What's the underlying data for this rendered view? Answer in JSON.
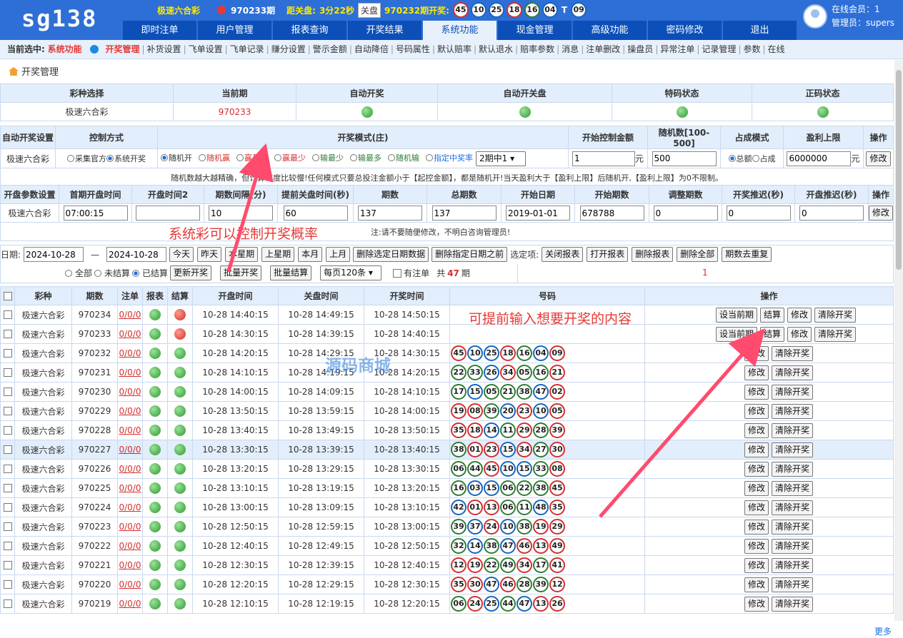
{
  "app": {
    "logo": "sg138"
  },
  "ticker": {
    "lottery": "极速六合彩",
    "period": "970233期",
    "countdown_label": "距关盘:",
    "countdown": "3分22秒",
    "closed": "关盘",
    "last_label": "970232期开奖:",
    "last_balls": [
      "45",
      "10",
      "25",
      "18",
      "16",
      "04"
    ],
    "t": "T",
    "special": "09"
  },
  "nav": [
    "即时注单",
    "用户管理",
    "报表查询",
    "开奖结果",
    "系统功能",
    "现金管理",
    "高级功能",
    "密码修改",
    "退出"
  ],
  "user": {
    "online": "在线会员：1",
    "admin": "管理员：supers"
  },
  "subnav": {
    "label": "当前选中:",
    "current": "系统功能",
    "items": [
      "开奖管理",
      "补货设置",
      "飞单设置",
      "飞单记录",
      "赚分设置",
      "警示金额",
      "自动降倍",
      "号码属性",
      "默认赔率",
      "默认退水",
      "赔率参数",
      "消息",
      "注单删改",
      "操盘员",
      "异常注单",
      "记录管理",
      "参数",
      "在线"
    ]
  },
  "breadcrumb": "开奖管理",
  "status_table": {
    "headers": [
      "彩种选择",
      "当前期",
      "自动开奖",
      "自动开关盘",
      "特码状态",
      "正码状态"
    ],
    "lottery": "极速六合彩",
    "period": "970233"
  },
  "auto_table": {
    "headers": [
      "自动开奖设置",
      "控制方式",
      "开奖模式(庄)",
      "开始控制金额",
      "随机数[100-500]",
      "占成模式",
      "盈利上限",
      "操作"
    ],
    "name": "极速六合彩",
    "control": [
      "采集官方",
      "系统开奖"
    ],
    "modes": [
      "随机开",
      "随机赢",
      "赢最多",
      "赢最少",
      "输最少",
      "输最多",
      "随机输"
    ],
    "specified": "指定中奖率",
    "specified_option": "2期中1",
    "start_amount": "1",
    "unit": "元",
    "random": "500",
    "share": [
      "总额",
      "占成"
    ],
    "profit": "6000000",
    "edit": "修改",
    "note": "随机数越大越精确，但计算速度比较慢!任何模式只要总投注金额小于【起控金额】，都是随机开!当天盈利大于【盈利上限】后随机开,【盈利上限】为0不限制。"
  },
  "open_table": {
    "headers": [
      "开盘参数设置",
      "首期开盘时间",
      "开盘时间2",
      "期数间隔(分)",
      "提前关盘时间(秒)",
      "期数",
      "总期数",
      "开始日期",
      "开始期数",
      "调整期数",
      "开奖推迟(秒)",
      "开盘推迟(秒)",
      "操作"
    ],
    "name": "极速六合彩",
    "first": "07:00:15",
    "time2": "",
    "interval": "10",
    "advance": "60",
    "periods": "137",
    "total": "137",
    "start_date": "2019-01-01",
    "start_period": "678788",
    "adjust": "0",
    "draw_delay": "0",
    "open_delay": "0",
    "edit": "修改",
    "note": "注:请不要随便修改，不明白咨询管理员!"
  },
  "annotations": {
    "note1": "系统彩可以控制开奖概率",
    "note2": "可提前输入想要开奖的内容",
    "watermark": "源码商城"
  },
  "filter": {
    "date_label": "日期:",
    "from": "2024-10-28",
    "dash": "—",
    "to": "2024-10-28",
    "quick": [
      "今天",
      "昨天",
      "本星期",
      "上星期",
      "本月",
      "上月"
    ],
    "del_sel": "删除选定日期数据",
    "del_before": "删除指定日期之前",
    "opts_label": "选定项:",
    "opts": [
      "关闭报表",
      "打开报表",
      "删除报表",
      "删除全部",
      "期数去重复"
    ],
    "status": [
      "全部",
      "未结算",
      "已结算"
    ],
    "update": "更新开奖",
    "batch_open": "批量开奖",
    "batch_settle": "批量结算",
    "per_page": "每页120条",
    "has_bets": "有注单",
    "total_prefix": "共",
    "total": "47",
    "total_suffix": "期",
    "page": "1"
  },
  "results": {
    "headers": [
      "彩种",
      "期数",
      "注单",
      "报表",
      "结算",
      "开盘时间",
      "关盘时间",
      "开奖时间",
      "号码",
      "操作"
    ],
    "rows": [
      {
        "lottery": "极速六合彩",
        "period": "970234",
        "bets": "0/0/0",
        "report": "green",
        "settle": "red",
        "open": "10-28 14:40:15",
        "close": "10-28 14:49:15",
        "draw": "10-28 14:50:15",
        "balls": [],
        "ops": [
          "设当前期",
          "结算",
          "修改",
          "清除开奖"
        ]
      },
      {
        "lottery": "极速六合彩",
        "period": "970233",
        "bets": "0/0/0",
        "report": "green",
        "settle": "red",
        "open": "10-28 14:30:15",
        "close": "10-28 14:39:15",
        "draw": "10-28 14:40:15",
        "balls": [],
        "ops": [
          "设当前期",
          "结算",
          "修改",
          "清除开奖"
        ]
      },
      {
        "lottery": "极速六合彩",
        "period": "970232",
        "bets": "0/0/0",
        "report": "green",
        "settle": "green",
        "open": "10-28 14:20:15",
        "close": "10-28 14:29:15",
        "draw": "10-28 14:30:15",
        "balls": [
          "45",
          "10",
          "25",
          "18",
          "16",
          "04",
          "09"
        ],
        "ops": [
          "修改",
          "清除开奖"
        ]
      },
      {
        "lottery": "极速六合彩",
        "period": "970231",
        "bets": "0/0/0",
        "report": "green",
        "settle": "green",
        "open": "10-28 14:10:15",
        "close": "10-28 14:19:15",
        "draw": "10-28 14:20:15",
        "balls": [
          "22",
          "33",
          "26",
          "34",
          "05",
          "16",
          "21"
        ],
        "ops": [
          "修改",
          "清除开奖"
        ]
      },
      {
        "lottery": "极速六合彩",
        "period": "970230",
        "bets": "0/0/0",
        "report": "green",
        "settle": "green",
        "open": "10-28 14:00:15",
        "close": "10-28 14:09:15",
        "draw": "10-28 14:10:15",
        "balls": [
          "17",
          "15",
          "05",
          "21",
          "38",
          "47",
          "02"
        ],
        "ops": [
          "修改",
          "清除开奖"
        ]
      },
      {
        "lottery": "极速六合彩",
        "period": "970229",
        "bets": "0/0/0",
        "report": "green",
        "settle": "green",
        "open": "10-28 13:50:15",
        "close": "10-28 13:59:15",
        "draw": "10-28 14:00:15",
        "balls": [
          "19",
          "08",
          "39",
          "20",
          "23",
          "10",
          "05"
        ],
        "ops": [
          "修改",
          "清除开奖"
        ]
      },
      {
        "lottery": "极速六合彩",
        "period": "970228",
        "bets": "0/0/0",
        "report": "green",
        "settle": "green",
        "open": "10-28 13:40:15",
        "close": "10-28 13:49:15",
        "draw": "10-28 13:50:15",
        "balls": [
          "35",
          "18",
          "14",
          "11",
          "29",
          "28",
          "39"
        ],
        "ops": [
          "修改",
          "清除开奖"
        ]
      },
      {
        "lottery": "极速六合彩",
        "period": "970227",
        "bets": "0/0/0",
        "report": "green",
        "settle": "green",
        "open": "10-28 13:30:15",
        "close": "10-28 13:39:15",
        "draw": "10-28 13:40:15",
        "balls": [
          "38",
          "01",
          "23",
          "15",
          "34",
          "27",
          "30"
        ],
        "ops": [
          "修改",
          "清除开奖"
        ]
      },
      {
        "lottery": "极速六合彩",
        "period": "970226",
        "bets": "0/0/0",
        "report": "green",
        "settle": "green",
        "open": "10-28 13:20:15",
        "close": "10-28 13:29:15",
        "draw": "10-28 13:30:15",
        "balls": [
          "06",
          "44",
          "45",
          "10",
          "15",
          "33",
          "08"
        ],
        "ops": [
          "修改",
          "清除开奖"
        ]
      },
      {
        "lottery": "极速六合彩",
        "period": "970225",
        "bets": "0/0/0",
        "report": "green",
        "settle": "green",
        "open": "10-28 13:10:15",
        "close": "10-28 13:19:15",
        "draw": "10-28 13:20:15",
        "balls": [
          "16",
          "03",
          "15",
          "06",
          "22",
          "38",
          "45"
        ],
        "ops": [
          "修改",
          "清除开奖"
        ]
      },
      {
        "lottery": "极速六合彩",
        "period": "970224",
        "bets": "0/0/0",
        "report": "green",
        "settle": "green",
        "open": "10-28 13:00:15",
        "close": "10-28 13:09:15",
        "draw": "10-28 13:10:15",
        "balls": [
          "42",
          "01",
          "13",
          "06",
          "11",
          "48",
          "35"
        ],
        "ops": [
          "修改",
          "清除开奖"
        ]
      },
      {
        "lottery": "极速六合彩",
        "period": "970223",
        "bets": "0/0/0",
        "report": "green",
        "settle": "green",
        "open": "10-28 12:50:15",
        "close": "10-28 12:59:15",
        "draw": "10-28 13:00:15",
        "balls": [
          "39",
          "37",
          "24",
          "10",
          "38",
          "19",
          "29"
        ],
        "ops": [
          "修改",
          "清除开奖"
        ]
      },
      {
        "lottery": "极速六合彩",
        "period": "970222",
        "bets": "0/0/0",
        "report": "green",
        "settle": "green",
        "open": "10-28 12:40:15",
        "close": "10-28 12:49:15",
        "draw": "10-28 12:50:15",
        "balls": [
          "32",
          "14",
          "38",
          "47",
          "46",
          "13",
          "49"
        ],
        "ops": [
          "修改",
          "清除开奖"
        ]
      },
      {
        "lottery": "极速六合彩",
        "period": "970221",
        "bets": "0/0/0",
        "report": "green",
        "settle": "green",
        "open": "10-28 12:30:15",
        "close": "10-28 12:39:15",
        "draw": "10-28 12:40:15",
        "balls": [
          "12",
          "19",
          "22",
          "49",
          "34",
          "17",
          "41"
        ],
        "ops": [
          "修改",
          "清除开奖"
        ]
      },
      {
        "lottery": "极速六合彩",
        "period": "970220",
        "bets": "0/0/0",
        "report": "green",
        "settle": "green",
        "open": "10-28 12:20:15",
        "close": "10-28 12:29:15",
        "draw": "10-28 12:30:15",
        "balls": [
          "35",
          "30",
          "47",
          "46",
          "28",
          "39",
          "12"
        ],
        "ops": [
          "修改",
          "清除开奖"
        ]
      },
      {
        "lottery": "极速六合彩",
        "period": "970219",
        "bets": "0/0/0",
        "report": "green",
        "settle": "green",
        "open": "10-28 12:10:15",
        "close": "10-28 12:19:15",
        "draw": "10-28 12:20:15",
        "balls": [
          "06",
          "24",
          "25",
          "44",
          "47",
          "13",
          "26"
        ],
        "ops": [
          "修改",
          "清除开奖"
        ]
      }
    ]
  },
  "more": "更多",
  "colors": {
    "header_blue": "#2d6fd6",
    "nav_blue": "#0c4fb8",
    "alert_red": "#e53935"
  }
}
